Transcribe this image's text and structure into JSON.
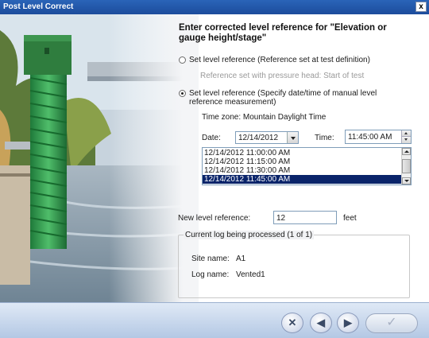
{
  "window": {
    "title": "Post Level Correct",
    "close_label": "x"
  },
  "heading": "Enter corrected level reference for \"Elevation or gauge height/stage\"",
  "option_test_definition": {
    "label": "Set level reference (Reference set at test definition)",
    "sub_label": "Reference set with pressure head: Start of test",
    "selected": false
  },
  "option_manual": {
    "label_line1": "Set level reference (Specify date/time of manual level",
    "label_line2": "reference measurement)",
    "selected": true
  },
  "timezone": "Time zone: Mountain Daylight Time",
  "date": {
    "label": "Date:",
    "value": "12/14/2012"
  },
  "time": {
    "label": "Time:",
    "value": "11:45:00 AM"
  },
  "time_list": {
    "items": [
      "12/14/2012 11:00:00 AM",
      "12/14/2012 11:15:00 AM",
      "12/14/2012 11:30:00 AM",
      "12/14/2012 11:45:00 AM"
    ],
    "selected_index": 3
  },
  "new_level": {
    "label": "New level reference:",
    "value": "12",
    "unit": "feet"
  },
  "current_log": {
    "legend": "Current log being processed (1 of 1)",
    "site_label": "Site name:",
    "site_value": "A1",
    "log_label": "Log name:",
    "log_value": "Vented1"
  },
  "buttons": {
    "cancel_glyph": "✕",
    "back_glyph": "◀",
    "next_glyph": "▶",
    "ok_glyph": "✓"
  },
  "colors": {
    "title_bar": "#1c4c9c",
    "list_selection": "#0a246a",
    "bottom_bar": "#b4c8e4"
  }
}
